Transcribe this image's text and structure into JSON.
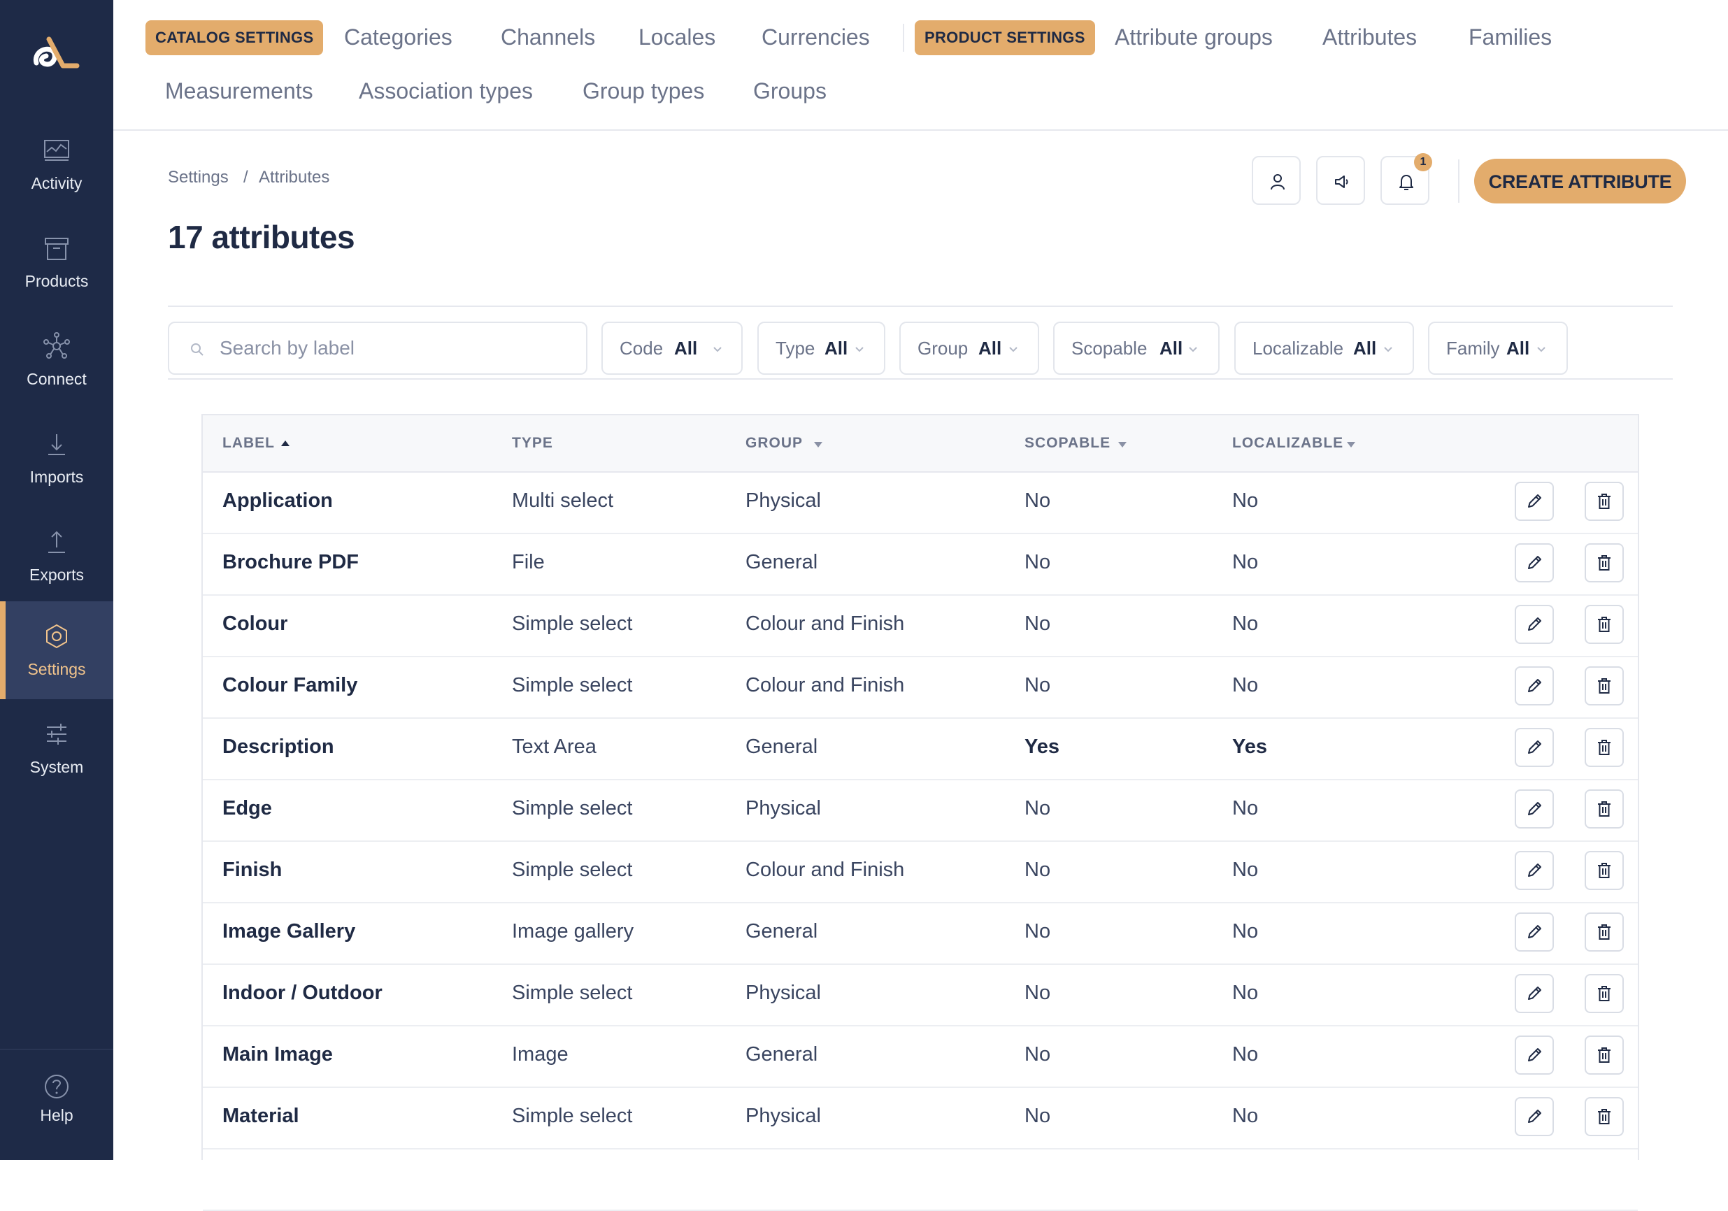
{
  "sidebar": {
    "items": [
      {
        "label": "Activity",
        "icon": "activity-icon"
      },
      {
        "label": "Products",
        "icon": "products-icon"
      },
      {
        "label": "Connect",
        "icon": "connect-icon"
      },
      {
        "label": "Imports",
        "icon": "imports-icon"
      },
      {
        "label": "Exports",
        "icon": "exports-icon"
      },
      {
        "label": "Settings",
        "icon": "settings-icon",
        "active": true
      },
      {
        "label": "System",
        "icon": "system-icon"
      }
    ],
    "help_label": "Help"
  },
  "topnav": {
    "catalog_chip": "CATALOG SETTINGS",
    "catalog_links": [
      "Categories",
      "Channels",
      "Locales",
      "Currencies"
    ],
    "product_chip": "PRODUCT SETTINGS",
    "product_links": [
      "Attribute groups",
      "Attributes",
      "Families"
    ],
    "second_row_links": [
      "Measurements",
      "Association types",
      "Group types",
      "Groups"
    ]
  },
  "breadcrumb": {
    "root": "Settings",
    "separator": "/",
    "current": "Attributes"
  },
  "page_title": "17 attributes",
  "header": {
    "notification_count": "1",
    "create_label": "CREATE ATTRIBUTE"
  },
  "filters": {
    "search_placeholder": "Search by label",
    "items": [
      {
        "label": "Code",
        "value": "All"
      },
      {
        "label": "Type",
        "value": "All"
      },
      {
        "label": "Group",
        "value": "All"
      },
      {
        "label": "Scopable",
        "value": "All"
      },
      {
        "label": "Localizable",
        "value": "All"
      },
      {
        "label": "Family",
        "value": "All"
      }
    ]
  },
  "table": {
    "columns": [
      "LABEL",
      "TYPE",
      "GROUP",
      "SCOPABLE",
      "LOCALIZABLE"
    ],
    "rows": [
      {
        "label": "Application",
        "type": "Multi select",
        "group": "Physical",
        "scopable": "No",
        "localizable": "No"
      },
      {
        "label": "Brochure PDF",
        "type": "File",
        "group": "General",
        "scopable": "No",
        "localizable": "No"
      },
      {
        "label": "Colour",
        "type": "Simple select",
        "group": "Colour and Finish",
        "scopable": "No",
        "localizable": "No"
      },
      {
        "label": "Colour Family",
        "type": "Simple select",
        "group": "Colour and Finish",
        "scopable": "No",
        "localizable": "No"
      },
      {
        "label": "Description",
        "type": "Text Area",
        "group": "General",
        "scopable": "Yes",
        "localizable": "Yes"
      },
      {
        "label": "Edge",
        "type": "Simple select",
        "group": "Physical",
        "scopable": "No",
        "localizable": "No"
      },
      {
        "label": "Finish",
        "type": "Simple select",
        "group": "Colour and Finish",
        "scopable": "No",
        "localizable": "No"
      },
      {
        "label": "Image Gallery",
        "type": "Image gallery",
        "group": "General",
        "scopable": "No",
        "localizable": "No"
      },
      {
        "label": "Indoor / Outdoor",
        "type": "Simple select",
        "group": "Physical",
        "scopable": "No",
        "localizable": "No"
      },
      {
        "label": "Main Image",
        "type": "Image",
        "group": "General",
        "scopable": "No",
        "localizable": "No"
      },
      {
        "label": "Material",
        "type": "Simple select",
        "group": "Physical",
        "scopable": "No",
        "localizable": "No"
      }
    ]
  },
  "colors": {
    "accent": "#e3ac6c",
    "sidebar": "#1e2a47",
    "sidebar_active": "#334062"
  }
}
